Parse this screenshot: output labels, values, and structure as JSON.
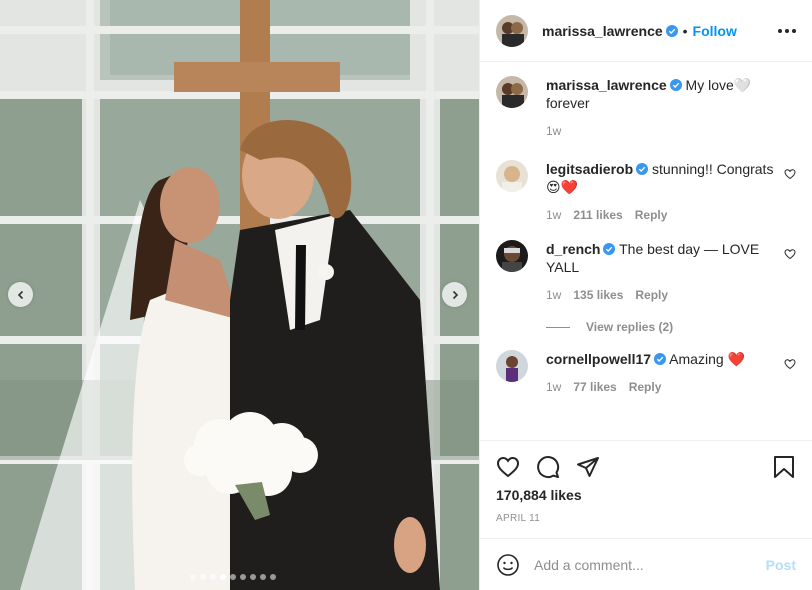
{
  "header": {
    "username": "marissa_lawrence",
    "separator": "•",
    "follow_label": "Follow"
  },
  "caption": {
    "username": "marissa_lawrence",
    "text": "My love🤍forever",
    "age": "1w"
  },
  "comments": [
    {
      "username": "legitsadierob",
      "text": "stunning!! Congrats 😍❤️",
      "age": "1w",
      "likes": "211 likes",
      "reply_label": "Reply"
    },
    {
      "username": "d_rench",
      "text": "The best day — LOVE YALL",
      "age": "1w",
      "likes": "135 likes",
      "reply_label": "Reply"
    },
    {
      "username": "cornellpowell17",
      "text": "Amazing ❤️",
      "age": "1w",
      "likes": "77 likes",
      "reply_label": "Reply"
    }
  ],
  "view_replies": "View replies (2)",
  "likes_count": "170,884 likes",
  "date": "APRIL 11",
  "add_comment": {
    "placeholder": "Add a comment...",
    "post_label": "Post"
  },
  "carousel": {
    "total": 9,
    "active_index": 3
  },
  "colors": {
    "accent": "#0095f6",
    "verified": "#3897f0",
    "post_disabled": "#b2dffc"
  }
}
